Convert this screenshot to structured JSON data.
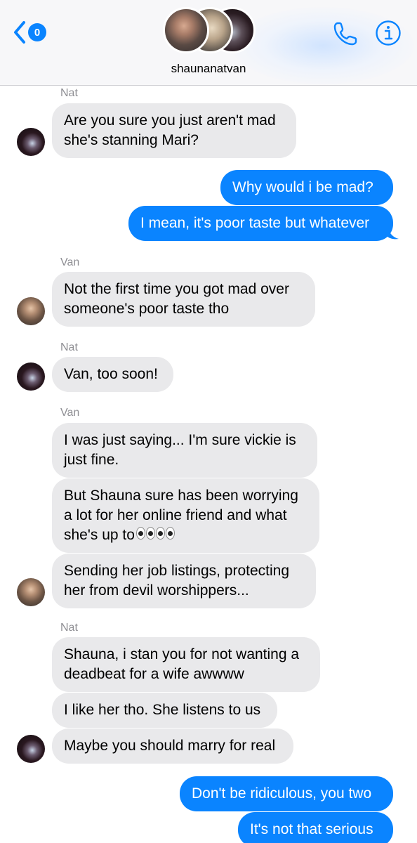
{
  "header": {
    "back_badge": "0",
    "conversation_name": "shaunanatvan",
    "accent_color": "#0a84ff"
  },
  "messages": [
    {
      "sender": "Nat"
    },
    {
      "text": "Are you sure you just aren't mad"
    },
    {
      "text": "she's stanning Mari?"
    },
    {
      "text": "Why would i be mad?"
    },
    {
      "text": "I mean, it's poor taste but whatever"
    },
    {
      "sender": "Van"
    },
    {
      "text": "Not the first time you got mad over"
    },
    {
      "text": "someone's poor taste tho"
    },
    {
      "sender": "Nat"
    },
    {
      "text": "Van, too soon!"
    },
    {
      "sender": "Van"
    },
    {
      "text": "I was just saying... I'm sure vickie is"
    },
    {
      "text": "just fine."
    },
    {
      "text": "But Shauna sure has been worrying"
    },
    {
      "text": "a lot for her online friend and what"
    },
    {
      "text": "she's up to"
    },
    {
      "text": "Sending her job listings, protecting"
    },
    {
      "text": "her from devil worshippers..."
    },
    {
      "sender": "Nat"
    },
    {
      "text": "Shauna, i stan you for not wanting a"
    },
    {
      "text": "deadbeat for a wife awwww"
    },
    {
      "text": "I like her tho. She listens to us"
    },
    {
      "text": "Maybe you should marry for real"
    },
    {
      "text": "Don't be ridiculous, you two"
    },
    {
      "text": "It's not that serious"
    }
  ],
  "colors": {
    "incoming_bubble": "#e9e9eb",
    "outgoing_bubble": "#0a84ff",
    "sender_label": "#8e8e93"
  },
  "icons": [
    "chevron-left-icon",
    "phone-icon",
    "info-icon",
    "eyes-emoji-icon"
  ]
}
